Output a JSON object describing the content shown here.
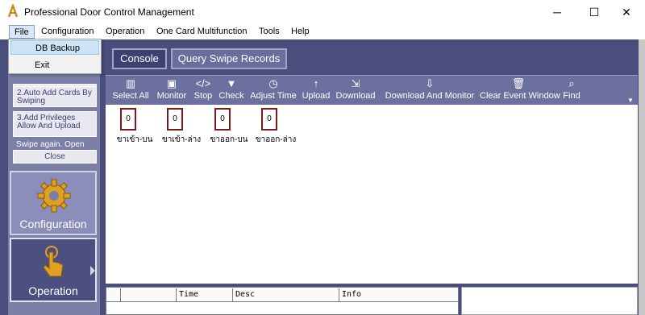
{
  "window": {
    "title": "Professional Door Control Management",
    "min_glyph": "─",
    "max_glyph": "☐",
    "close_glyph": "✕"
  },
  "menu": {
    "items": [
      "File",
      "Configuration",
      "Operation",
      "One Card Multifunction",
      "Tools",
      "Help"
    ]
  },
  "file_menu": {
    "items": [
      "DB Backup",
      "Exit"
    ]
  },
  "left_panel": {
    "steps": [
      "2.Auto Add Cards By Swiping",
      "3.Add Privileges Allow And Upload"
    ],
    "tip": "Swipe again. Open",
    "close_label": "Close",
    "nav": [
      {
        "label": "Configuration",
        "icon": "gear-icon"
      },
      {
        "label": "Operation",
        "icon": "hand-pointer-icon"
      }
    ]
  },
  "tabs": [
    "Console",
    "Query Swipe Records"
  ],
  "toolbar": {
    "items": [
      {
        "label": "Select All",
        "icon": "select-all-icon",
        "glyph": "▥"
      },
      {
        "label": "Monitor",
        "icon": "monitor-icon",
        "glyph": "▣"
      },
      {
        "label": "Stop",
        "icon": "stop-icon",
        "glyph": "</>"
      },
      {
        "label": "Check",
        "icon": "check-icon",
        "glyph": "▼"
      },
      {
        "label": "Adjust Time",
        "icon": "clock-icon",
        "glyph": "◷"
      },
      {
        "label": "Upload",
        "icon": "upload-icon",
        "glyph": "↑"
      },
      {
        "label": "Download",
        "icon": "download-icon",
        "glyph": "⇲"
      },
      {
        "label": "Download And Monitor",
        "icon": "download-monitor-icon",
        "glyph": "⇩"
      },
      {
        "label": "Clear Event Window",
        "icon": "trash-icon",
        "glyph": "🗑"
      },
      {
        "label": "Find",
        "icon": "search-icon",
        "glyph": "⌕"
      }
    ]
  },
  "doors": [
    {
      "value": "0",
      "label": "ขาเข้า-บน"
    },
    {
      "value": "0",
      "label": "ขาเข้า-ล่าง"
    },
    {
      "value": "0",
      "label": "ขาออก-บน"
    },
    {
      "value": "0",
      "label": "ขาออก-ล่าง"
    }
  ],
  "event_table": {
    "columns": [
      "",
      "",
      "Time",
      "Desc",
      "Info"
    ]
  },
  "colors": {
    "panel_bg": "#4a4e7d",
    "toolbar_bg": "#6c709e",
    "door_border": "#7a1a1a"
  }
}
